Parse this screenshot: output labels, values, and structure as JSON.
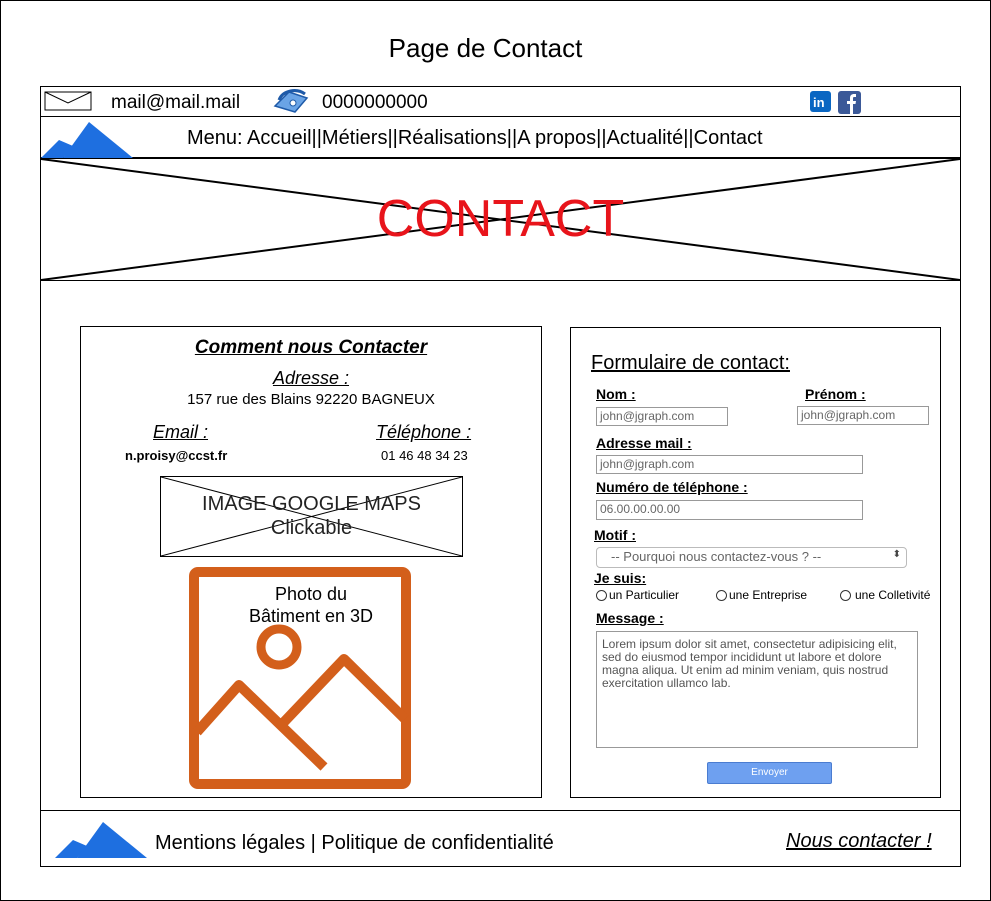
{
  "page_title": "Page de Contact",
  "topbar": {
    "email": "mail@mail.mail",
    "phone": "0000000000",
    "social": [
      "linkedin-icon",
      "facebook-icon"
    ]
  },
  "nav": {
    "menu": "Menu: Accueil||Métiers||Réalisations||A propos||Actualité||Contact"
  },
  "banner": {
    "title": "CONTACT"
  },
  "info": {
    "title": "Comment nous Contacter",
    "address_label": "Adresse :",
    "address_value": "157 rue des Blains 92220 BAGNEUX",
    "email_label": "Email :",
    "email_value": "n.proisy@ccst.fr",
    "phone_label": "Téléphone :",
    "phone_value": "01 46 48 34 23",
    "map_line1": "IMAGE GOOGLE MAPS",
    "map_line2": "Clickable",
    "photo_line1": "Photo du",
    "photo_line2": "Bâtiment  en 3D"
  },
  "form": {
    "title": "Formulaire de contact:",
    "nom_label": "Nom :",
    "nom_value": "john@jgraph.com",
    "prenom_label": "Prénom :",
    "prenom_value": "john@jgraph.com",
    "email_label": "Adresse mail :",
    "email_value": "john@jgraph.com",
    "phone_label": "Numéro de téléphone :",
    "phone_value": "06.00.00.00.00",
    "motif_label": "Motif :",
    "motif_value": "-- Pourquoi nous contactez-vous ? --",
    "jesuis_label": "Je suis:",
    "options": [
      "un Particulier",
      "une Entreprise",
      "une Colletivité"
    ],
    "message_label": "Message :",
    "message_value": "Lorem ipsum dolor sit amet, consectetur adipisicing elit, sed do eiusmod tempor incididunt ut labore et dolore magna aliqua. Ut enim ad minim veniam, quis nostrud exercitation ullamco lab.",
    "submit_label": "Envoyer"
  },
  "footer": {
    "links": "Mentions légales | Politique de confidentialité",
    "contact": "Nous contacter !"
  },
  "colors": {
    "banner_text": "#e8141b",
    "logo_blue": "#1e6fe0",
    "photo_icon": "#d35f1b",
    "button": "#6ea0f0",
    "linkedin": "#0a66c2",
    "facebook": "#3b5998"
  }
}
